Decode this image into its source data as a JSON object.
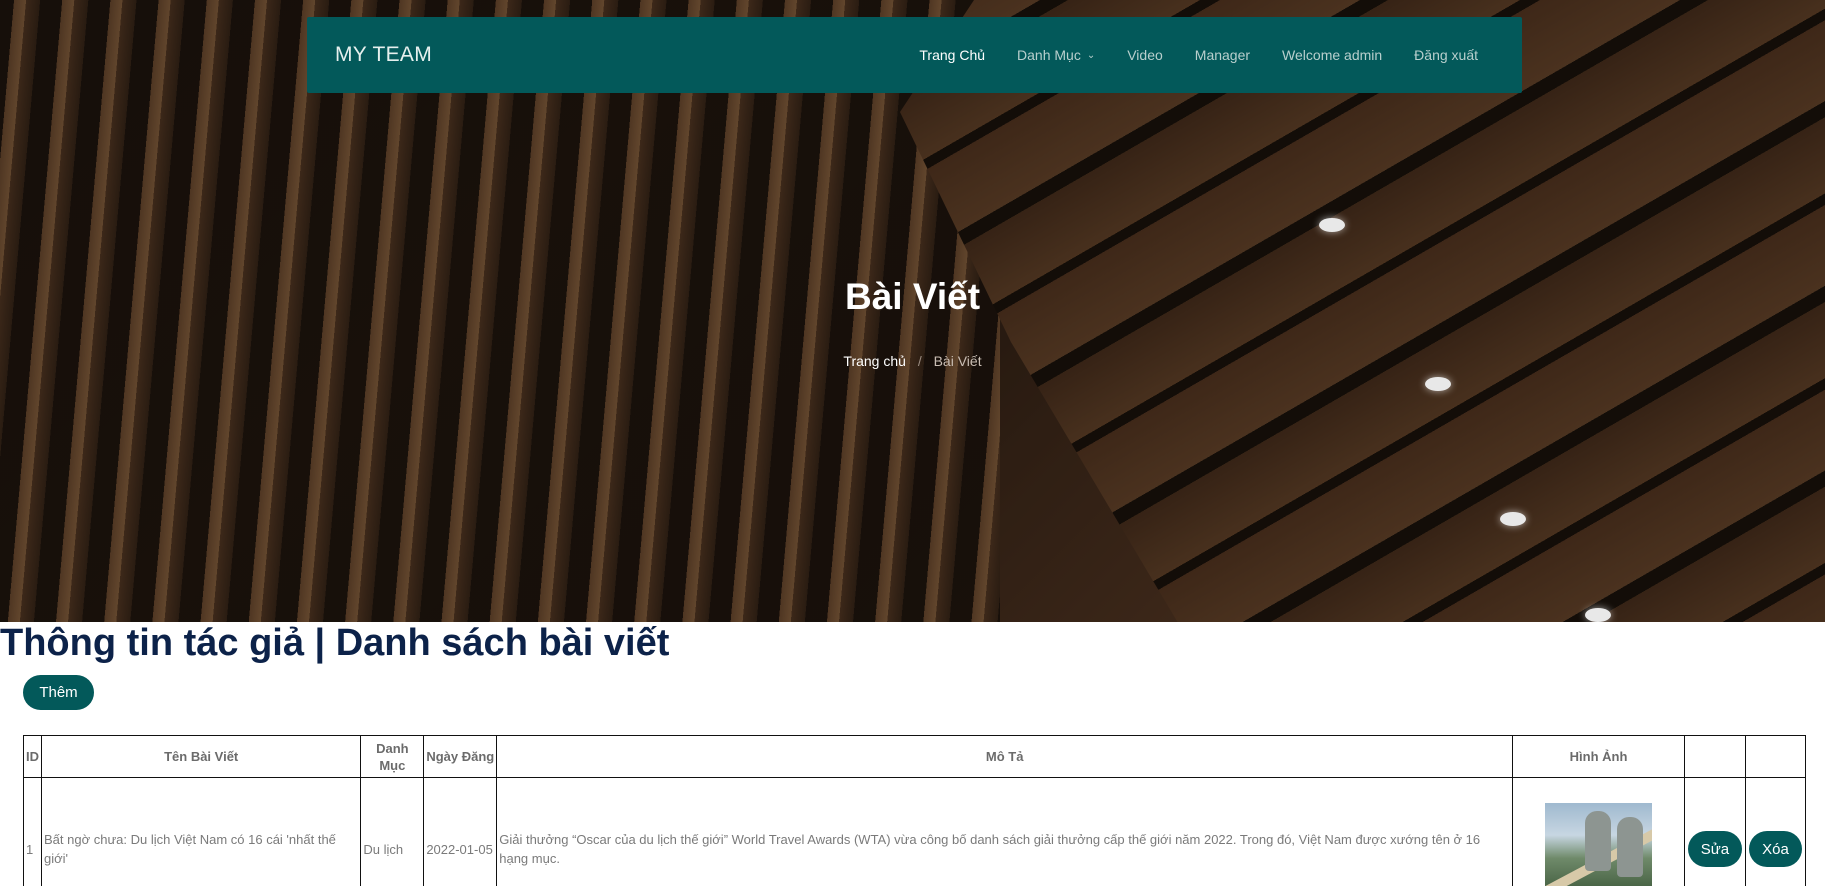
{
  "navbar": {
    "brand": "MY TEAM",
    "items": [
      {
        "label": "Trang Chủ"
      },
      {
        "label": "Danh Mục"
      },
      {
        "label": "Video"
      },
      {
        "label": "Manager"
      },
      {
        "label": "Welcome admin"
      },
      {
        "label": "Đăng xuất"
      }
    ]
  },
  "hero": {
    "title": "Bài Viết",
    "breadcrumb": {
      "home": "Trang chủ",
      "separator": "/",
      "current": "Bài Viết"
    }
  },
  "main": {
    "title": "Thông tin tác giả | Danh sách bài viết",
    "add_button": "Thêm",
    "table": {
      "headers": [
        "ID",
        "Tên Bài Viết",
        "Danh Mục",
        "Ngày Đăng",
        "Mô Tả",
        "Hình Ảnh",
        "",
        ""
      ],
      "rows": [
        {
          "id": "1",
          "title": "Bất ngờ chưa: Du lịch Việt Nam có 16 cái 'nhất thế giới'",
          "category": "Du lịch",
          "date": "2022-01-05",
          "description": "Giải thưởng “Oscar của du lịch thế giới” World Travel Awards (WTA) vừa công bố danh sách giải thưởng cấp thế giới năm 2022. Trong đó, Việt Nam được xướng tên ở 16 hạng mục.",
          "edit_label": "Sửa",
          "delete_label": "Xóa"
        }
      ]
    }
  },
  "colors": {
    "primary": "#03595a",
    "heading": "#0c2249"
  }
}
